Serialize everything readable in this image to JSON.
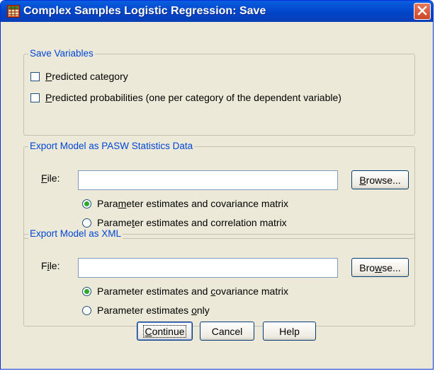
{
  "window": {
    "title": "Complex Samples Logistic Regression: Save"
  },
  "save_variables": {
    "legend": "Save Variables",
    "predicted_category": {
      "pre": "",
      "key": "P",
      "post": "redicted category",
      "checked": false
    },
    "predicted_probabilities": {
      "pre": "",
      "key": "P",
      "post": "redicted probabilities (one per category of the dependent variable)",
      "checked": false
    }
  },
  "export_pasw": {
    "legend": "Export Model as PASW Statistics Data",
    "file_label": {
      "pre": "",
      "key": "F",
      "post": "ile:"
    },
    "file_value": "",
    "browse": {
      "pre": "",
      "key": "B",
      "post": "rowse..."
    },
    "option1": {
      "pre": "Para",
      "key": "m",
      "post": "eter estimates and covariance matrix",
      "selected": true
    },
    "option2": {
      "pre": "Parame",
      "key": "t",
      "post": "er estimates and correlation matrix",
      "selected": false
    }
  },
  "export_xml": {
    "legend": "Export Model as XML",
    "file_label": {
      "pre": "F",
      "key": "i",
      "post": "le:"
    },
    "file_value": "",
    "browse": {
      "pre": "Bro",
      "key": "w",
      "post": "se..."
    },
    "option1": {
      "pre": "Parameter estimates and ",
      "key": "c",
      "post": "ovariance matrix",
      "selected": true
    },
    "option2": {
      "pre": "Parameter estimates ",
      "key": "o",
      "post": "nly",
      "selected": false
    }
  },
  "buttons": {
    "continue": {
      "pre": "",
      "key": "C",
      "post": "ontinue"
    },
    "cancel": "Cancel",
    "help": "Help"
  }
}
